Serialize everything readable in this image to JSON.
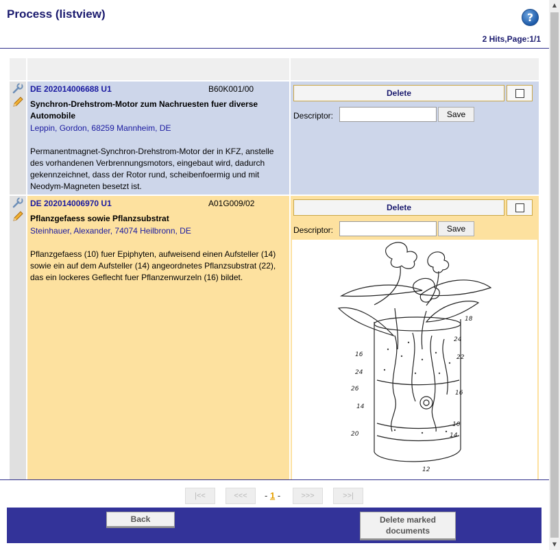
{
  "header": {
    "title": "Process (listview)",
    "help_icon": "?",
    "hits": "2 Hits,Page:1/1"
  },
  "records": [
    {
      "pub_no": "DE 202014006688 U1",
      "ipc": "B60K001/00",
      "title": "Synchron-Drehstrom-Motor zum Nachruesten fuer diverse Automobile",
      "applicant": "Leppin, Gordon, 68259 Mannheim, DE",
      "abstract": "Permanentmagnet-Synchron-Drehstrom-Motor der in KFZ, anstelle des vorhandenen Verbrennungsmotors, eingebaut wird, dadurch gekennzeichnet, dass der Rotor rund, scheibenfoermig und mit Neodym-Magneten besetzt ist.",
      "delete_label": "Delete",
      "descriptor_label": "Descriptor:",
      "descriptor_value": "",
      "save_label": "Save"
    },
    {
      "pub_no": "DE 202014006970 U1",
      "ipc": "A01G009/02",
      "title": "Pflanzgefaess sowie Pflanzsubstrat",
      "applicant": "Steinhauer, Alexander, 74074 Heilbronn, DE",
      "abstract": "Pflanzgefaess (10) fuer Epiphyten, aufweisend einen Aufsteller (14) sowie ein auf dem Aufsteller (14) angeordnetes Pflanzsubstrat (22), das ein lockeres Geflecht fuer Pflanzenwurzeln (16) bildet.",
      "delete_label": "Delete",
      "descriptor_label": "Descriptor:",
      "descriptor_value": "",
      "save_label": "Save",
      "drawing_labels": [
        "18",
        "24",
        "22",
        "16",
        "24",
        "26",
        "14",
        "16",
        "10",
        "20",
        "14",
        "12"
      ]
    }
  ],
  "pager": {
    "first": "|<<",
    "prev": "<<<",
    "current_prefix": "-",
    "current": "1",
    "current_suffix": "-",
    "next": ">>>",
    "last": ">>|"
  },
  "footer": {
    "back_label": "Back",
    "delete_marked_line1": "Delete marked",
    "delete_marked_line2": "documents"
  },
  "icons": {
    "tool": "wrench-icon",
    "edit": "pencil-icon",
    "help": "help-icon"
  },
  "colors": {
    "row1_bg": "#cdd6ea",
    "row2_bg": "#fde19f",
    "footer_bg": "#333399",
    "link": "#1a1aa0"
  }
}
